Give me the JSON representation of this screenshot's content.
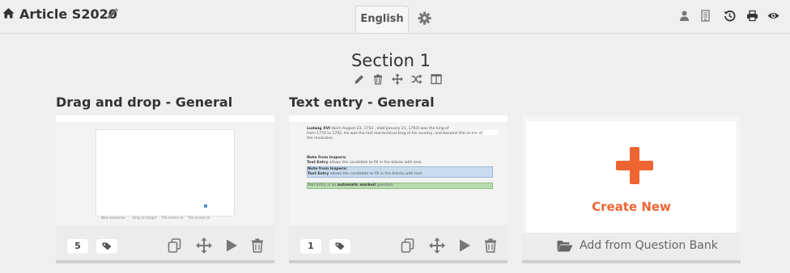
{
  "header": {
    "title": "Article S2020",
    "language_tab": "English",
    "icons": [
      "home-icon",
      "pencil-icon",
      "gear-icon",
      "user-icon",
      "document-icon",
      "history-icon",
      "print-icon",
      "eye-icon"
    ]
  },
  "section": {
    "title": "Section 1",
    "tools": [
      "pencil-icon",
      "trash-icon",
      "move-icon",
      "shuffle-icon",
      "columns-icon"
    ]
  },
  "cards": [
    {
      "heading": "Drag and drop - General",
      "count": "5",
      "preview": {
        "labels": [
          "New assessme",
          "Drop on target",
          "The screen at",
          "The screen at"
        ]
      },
      "footer_icons": [
        "duplicate-icon",
        "move-icon",
        "play-icon",
        "trash-icon"
      ]
    },
    {
      "heading": "Text entry - General",
      "count": "1",
      "preview": {
        "para1_bold": "Ludwig XVI",
        "para1_rest": "(born August 23, 1754 , died January 21, 1793) was the king of",
        "para1_line2": "from 1774 to 1792. He was the last monarchical king of his country, and became the victim of",
        "para1_line3": "the revolution.",
        "note1_heading": "Note from Inspera:",
        "note1_bold": "Text Entry",
        "note1_text": "allows the candidate to fill in the blanks with text.",
        "note2_heading": "Note from Inspera:",
        "note2_bold": "Text Entry",
        "note2_text": "allows the candidate to fill in the blanks with text.",
        "note3_prefix": "Text Entry is an",
        "note3_bold": "automatic marked",
        "note3_suffix": "question."
      },
      "footer_icons": [
        "duplicate-icon",
        "move-icon",
        "play-icon",
        "trash-icon"
      ]
    }
  ],
  "create_card": {
    "label": "Create New",
    "bank_label": "Add from Question Bank"
  },
  "colors": {
    "accent": "#ee6532",
    "icon_gray": "#777777",
    "background": "#efefef"
  }
}
